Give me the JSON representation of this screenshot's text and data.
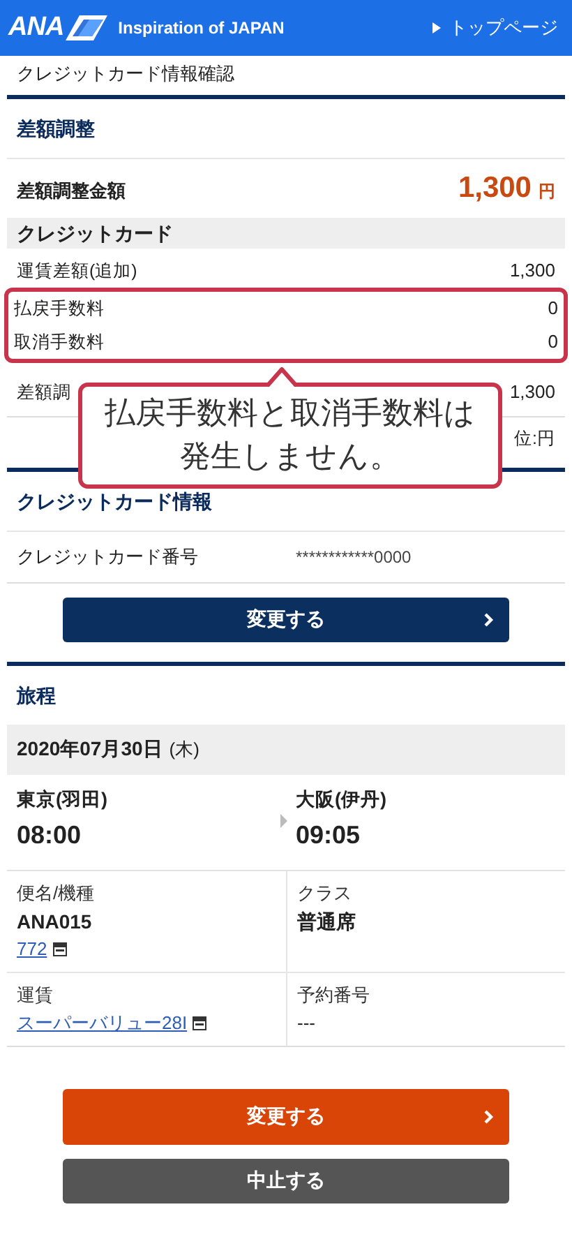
{
  "header": {
    "logo": "ANA",
    "tagline": "Inspiration of JAPAN",
    "top_link": "トップページ"
  },
  "breadcrumb": "クレジットカード情報確認",
  "adjustment": {
    "title": "差額調整",
    "total_label": "差額調整金額",
    "total_amount": "1,300",
    "total_unit": "円",
    "card_heading": "クレジットカード",
    "rows": [
      {
        "label": "運賃差額(追加)",
        "value": "1,300",
        "highlighted": false
      },
      {
        "label": "払戻手数料",
        "value": "0",
        "highlighted": true
      },
      {
        "label": "取消手数料",
        "value": "0",
        "highlighted": true
      },
      {
        "label": "差額調",
        "value": "1,300",
        "highlighted": false
      }
    ],
    "unit_note": "位:円"
  },
  "callout": {
    "text": "払戻手数料と取消手数料は発生しません。"
  },
  "card_info": {
    "title": "クレジットカード情報",
    "number_label": "クレジットカード番号",
    "number": "************0000",
    "button": "変更する"
  },
  "itinerary": {
    "title": "旅程",
    "date": "2020年07月30日",
    "weekday": "(木)",
    "departure": {
      "city": "東京(羽田)",
      "time": "08:00"
    },
    "arrival": {
      "city": "大阪(伊丹)",
      "time": "09:05"
    },
    "details": [
      {
        "label": "便名/機種",
        "lines": [
          {
            "text": "ANA015",
            "kind": "bold"
          },
          {
            "text": "772",
            "kind": "link"
          }
        ]
      },
      {
        "label": "クラス",
        "lines": [
          {
            "text": "普通席",
            "kind": "bold"
          }
        ]
      },
      {
        "label": "運賃",
        "lines": [
          {
            "text": "スーパーバリュー28I",
            "kind": "link"
          }
        ]
      },
      {
        "label": "予約番号",
        "lines": [
          {
            "text": "---",
            "kind": "plain"
          }
        ]
      }
    ]
  },
  "actions": [
    {
      "label": "変更する",
      "kind": "primary"
    },
    {
      "label": "中止する",
      "kind": "secondary"
    }
  ]
}
